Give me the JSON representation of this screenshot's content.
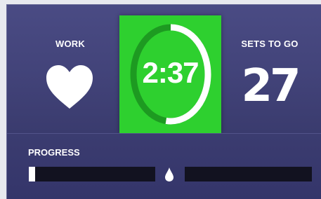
{
  "work": {
    "label": "WORK",
    "icon": "heart-icon"
  },
  "timer": {
    "value": "2:37",
    "remaining_fraction": 0.52,
    "accent_color": "#2ed02f"
  },
  "sets": {
    "label": "SETS TO GO",
    "value": "27"
  },
  "progress": {
    "label": "PROGRESS",
    "fraction": 0.05,
    "marker_icon": "drop-icon"
  },
  "colors": {
    "background": "#3d3e72",
    "track": "#121220",
    "text": "#ffffff"
  }
}
